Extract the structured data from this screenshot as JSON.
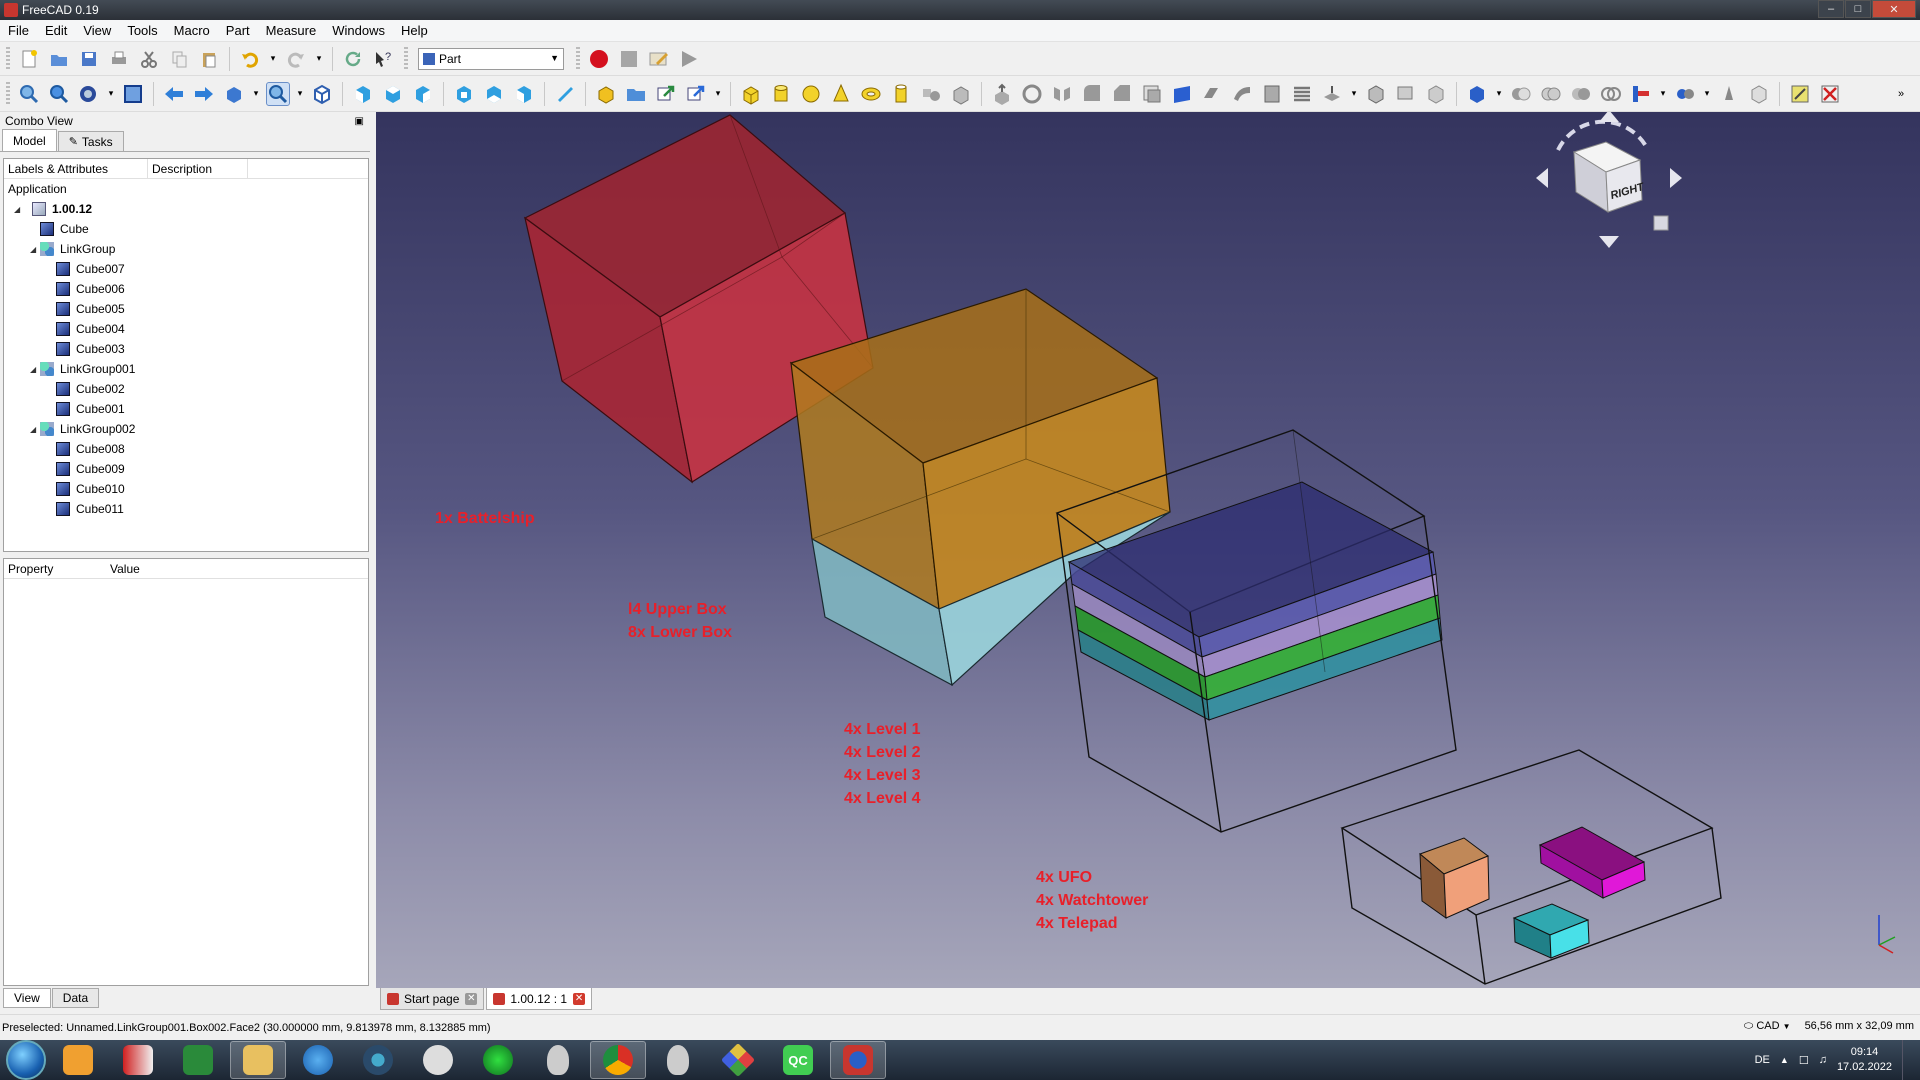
{
  "window": {
    "title": "FreeCAD 0.19"
  },
  "menu": [
    "File",
    "Edit",
    "View",
    "Tools",
    "Macro",
    "Part",
    "Measure",
    "Windows",
    "Help"
  ],
  "toolbar": {
    "workbench": "Part"
  },
  "combo": {
    "title": "Combo View",
    "tabs": [
      "Model",
      "Tasks"
    ],
    "tree_columns": [
      "Labels & Attributes",
      "Description"
    ],
    "application_label": "Application",
    "document": "1.00.12",
    "items": [
      {
        "label": "Cube",
        "level": 1,
        "type": "cube"
      },
      {
        "label": "LinkGroup",
        "level": 1,
        "type": "group",
        "expanded": true
      },
      {
        "label": "Cube007",
        "level": 2,
        "type": "cube"
      },
      {
        "label": "Cube006",
        "level": 2,
        "type": "cube"
      },
      {
        "label": "Cube005",
        "level": 2,
        "type": "cube"
      },
      {
        "label": "Cube004",
        "level": 2,
        "type": "cube"
      },
      {
        "label": "Cube003",
        "level": 2,
        "type": "cube"
      },
      {
        "label": "LinkGroup001",
        "level": 1,
        "type": "group",
        "expanded": true
      },
      {
        "label": "Cube002",
        "level": 2,
        "type": "cube"
      },
      {
        "label": "Cube001",
        "level": 2,
        "type": "cube"
      },
      {
        "label": "LinkGroup002",
        "level": 1,
        "type": "group",
        "expanded": true
      },
      {
        "label": "Cube008",
        "level": 2,
        "type": "cube"
      },
      {
        "label": "Cube009",
        "level": 2,
        "type": "cube"
      },
      {
        "label": "Cube010",
        "level": 2,
        "type": "cube"
      },
      {
        "label": "Cube011",
        "level": 2,
        "type": "cube"
      }
    ],
    "property_columns": [
      "Property",
      "Value"
    ],
    "property_tabs": [
      "View",
      "Data"
    ]
  },
  "viewport": {
    "annotations": {
      "battleship": "1x Battelship",
      "boxes": "l4 Upper Box\n8x Lower Box",
      "levels": "4x Level 1\n4x Level 2\n4x Level 3\n4x Level 4",
      "small": "4x UFO\n4x Watchtower\n4x Telepad"
    },
    "navcube_face": "RIGHT",
    "colors": {
      "red_box": "#c0303c",
      "orange_box": "#c88a1c",
      "cyan_box": "#8ed0dc",
      "level_navy": "#3a3a80",
      "level_green": "#2ea830",
      "ufo": "#e89870",
      "watchtower": "#d010c0",
      "telepad": "#40d0d8"
    }
  },
  "doc_tabs": [
    {
      "label": "Start page",
      "active": false
    },
    {
      "label": "1.00.12 : 1",
      "active": true
    }
  ],
  "status": {
    "message": "Preselected: Unnamed.LinkGroup001.Box002.Face2 (30.000000 mm, 9.813978 mm, 8.132885 mm)",
    "nav_style": "CAD",
    "dimensions": "56,56 mm x 32,09 mm"
  },
  "taskbar": {
    "language": "DE",
    "time": "09:14",
    "date": "17.02.2022"
  }
}
